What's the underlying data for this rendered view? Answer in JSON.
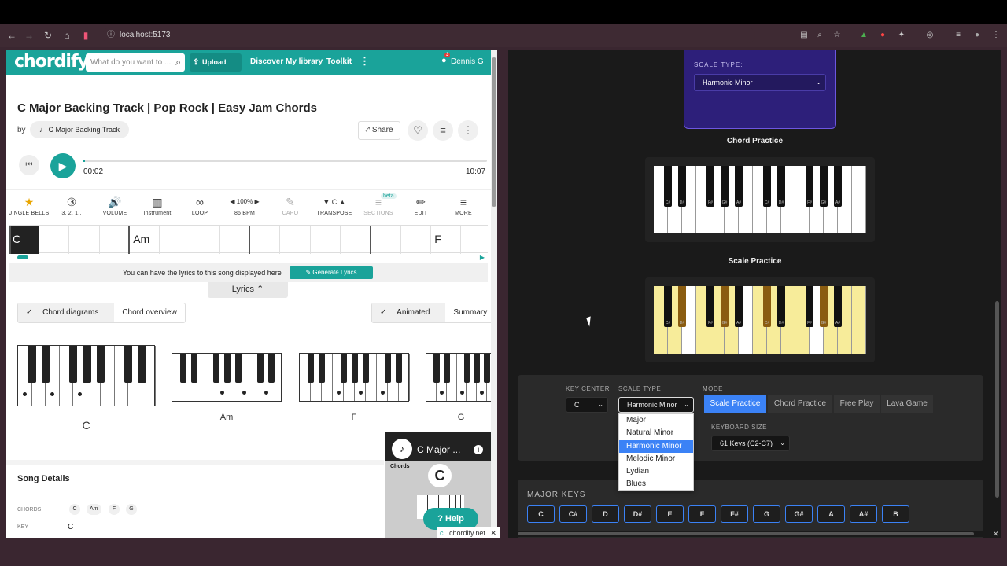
{
  "browser": {
    "url": "localhost:5173"
  },
  "chordify": {
    "logo": "chordify",
    "search_placeholder": "What do you want to ...",
    "upload": "Upload song",
    "nav": [
      "Discover",
      "My library",
      "Toolkit"
    ],
    "notif_count": "3",
    "user": "Dennis G",
    "song_title": "C Major Backing Track | Pop Rock | Easy Jam Chords",
    "by": "by",
    "artist": "C Major Backing Track",
    "share": "Share",
    "time_current": "00:02",
    "time_total": "10:07",
    "progress": 0.003,
    "tools": [
      {
        "icon": "★",
        "label": "JINGLE BELLS"
      },
      {
        "icon": "③",
        "label": "3, 2, 1.."
      },
      {
        "icon": "🔊",
        "label": "VOLUME"
      },
      {
        "icon": "▥",
        "label": "Instrument"
      },
      {
        "icon": "∞",
        "label": "LOOP"
      },
      {
        "icon": "◀ 100% ▶",
        "label": "86 BPM"
      },
      {
        "icon": "✎",
        "label": "CAPO"
      },
      {
        "icon": "▼ C ▲",
        "label": "TRANSPOSE"
      },
      {
        "icon": "≡",
        "label": "SECTIONS"
      },
      {
        "icon": "✏",
        "label": "EDIT"
      },
      {
        "icon": "≡",
        "label": "MORE"
      }
    ],
    "beta": "beta",
    "strip_chords": [
      "C",
      "Am",
      "F"
    ],
    "lyrics_msg": "You can have the lyrics to this song displayed here",
    "gen_lyrics": "Generate Lyrics",
    "lyrics_tab": "Lyrics",
    "seg_left": [
      "Chord diagrams",
      "Chord overview"
    ],
    "seg_right": [
      "Animated",
      "Summary"
    ],
    "diagrams": [
      "C",
      "Am",
      "F",
      "G"
    ],
    "details_title": "Song Details",
    "chords_label": "CHORDS",
    "chords": [
      "C",
      "Am",
      "F",
      "G"
    ],
    "key_label": "KEY",
    "key_value": "C",
    "video_title": "C Major ...",
    "video_chords": "Chords",
    "help": "Help",
    "tab_label": "chordify.net"
  },
  "app": {
    "scale_type_label": "SCALE TYPE:",
    "scale_type_value": "Harmonic Minor",
    "chord_practice_title": "Chord Practice",
    "scale_practice_title": "Scale Practice",
    "black_key_labels": [
      "C#",
      "D#",
      "F#",
      "G#",
      "A#",
      "C#",
      "D#",
      "F#",
      "G#",
      "A#"
    ],
    "key_center_label": "KEY CENTER",
    "key_center_value": "C",
    "scale_type_label2": "SCALE TYPE",
    "scale_type_value2": "Harmonic Minor",
    "mode_label": "MODE",
    "modes": [
      "Scale Practice",
      "Chord Practice",
      "Free Play",
      "Lava Game"
    ],
    "active_mode": "Scale Practice",
    "keyboard_size_label": "KEYBOARD SIZE",
    "keyboard_size_value": "61 Keys (C2-C7)",
    "scale_options": [
      "Major",
      "Natural Minor",
      "Harmonic Minor",
      "Melodic Minor",
      "Lydian",
      "Blues"
    ],
    "selected_option": "Harmonic Minor",
    "major_keys_title": "MAJOR KEYS",
    "major_keys": [
      "C",
      "C#",
      "D",
      "D#",
      "E",
      "F",
      "F#",
      "G",
      "G#",
      "A",
      "A#",
      "B"
    ],
    "colors": {
      "highlight": "#f7ec9a",
      "highlight_dark": "#8a5c10",
      "accent": "#3b82f6",
      "chordify": "#1aa39a"
    }
  }
}
